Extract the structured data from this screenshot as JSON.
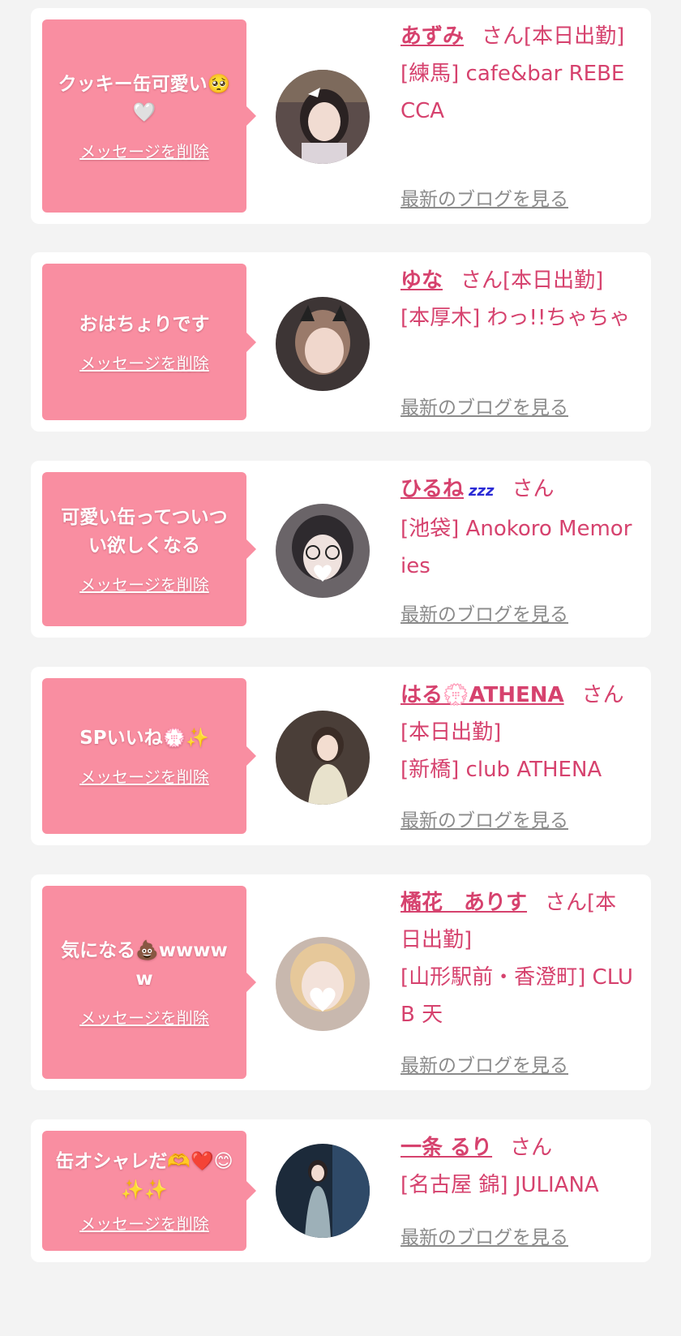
{
  "colors": {
    "bubble": "#f98ea1",
    "name": "#d6426e",
    "link_gray": "#8b8b8b",
    "background": "#f3f3f3"
  },
  "entries": [
    {
      "message": "クッキー缶可愛い🥺🤍",
      "delete_label": "メッセージを削除",
      "name": "あずみ",
      "name_suffix": "",
      "honorific": "さん[本日出勤]",
      "location": "[練馬] cafe&bar REBECCA",
      "blog_label": "最新のブログを見る"
    },
    {
      "message": "おはちょりです",
      "delete_label": "メッセージを削除",
      "name": "ゆな",
      "name_suffix": "",
      "honorific": "さん[本日出勤]",
      "location": "[本厚木] わっ!!ちゃちゃ",
      "blog_label": "最新のブログを見る"
    },
    {
      "message": "可愛い缶ってついつい欲しくなる",
      "delete_label": "メッセージを削除",
      "name": "ひるね",
      "name_suffix": "zzz",
      "honorific": "さん",
      "location": "[池袋] Anokoro Memories",
      "blog_label": "最新のブログを見る"
    },
    {
      "message": "SPいいね💮✨",
      "delete_label": "メッセージを削除",
      "name": "はる💮ATHENA",
      "name_suffix": "",
      "honorific": "さん[本日出勤]",
      "location": "[新橋] club ATHENA",
      "blog_label": "最新のブログを見る"
    },
    {
      "message": "気になる💩wwwww",
      "delete_label": "メッセージを削除",
      "name": "橘花　ありす",
      "name_suffix": "",
      "honorific": "さん[本日出勤]",
      "location": "[山形駅前・香澄町] CLUB 天",
      "blog_label": "最新のブログを見る"
    },
    {
      "message": "缶オシャレだ🫶❤️😊✨✨",
      "delete_label": "メッセージを削除",
      "name": "一条 るり",
      "name_suffix": "",
      "honorific": "さん",
      "location": "[名古屋 錦] JULIANA",
      "blog_label": "最新のブログを見る"
    }
  ]
}
